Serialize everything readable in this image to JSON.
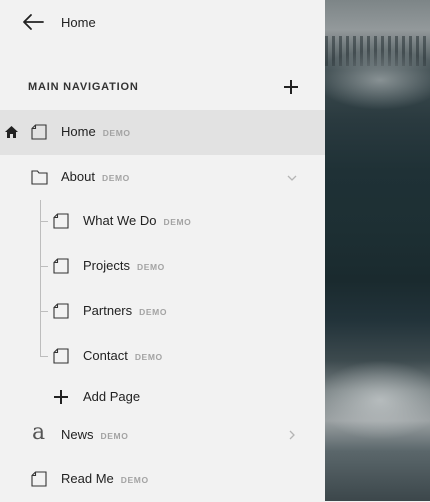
{
  "header": {
    "back_label": "Home"
  },
  "section": {
    "title": "MAIN NAVIGATION"
  },
  "badge": "DEMO",
  "nav": [
    {
      "label": "Home",
      "icon": "page-icon",
      "home": true,
      "selected": true
    },
    {
      "label": "About",
      "icon": "folder-icon",
      "expanded": true
    },
    {
      "label": "What We Do",
      "icon": "page-icon",
      "child": true
    },
    {
      "label": "Projects",
      "icon": "page-icon",
      "child": true
    },
    {
      "label": "Partners",
      "icon": "page-icon",
      "child": true
    },
    {
      "label": "Contact",
      "icon": "page-icon",
      "child": true
    },
    {
      "label": "News",
      "icon": "blog-icon",
      "collapsed": true
    },
    {
      "label": "Read Me",
      "icon": "page-icon"
    }
  ],
  "add_page_label": "Add Page"
}
